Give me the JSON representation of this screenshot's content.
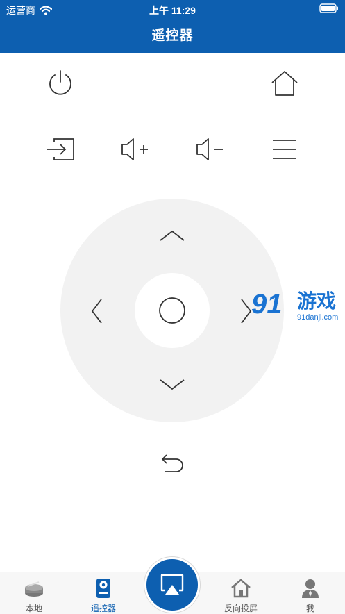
{
  "colors": {
    "brand": "#0d5fb0",
    "pad": "#f2f2f2"
  },
  "status": {
    "carrier": "运营商",
    "time": "上午 11:29"
  },
  "header": {
    "title": "遥控器"
  },
  "remote": {
    "power": "power-icon",
    "home": "home-icon",
    "input": "input-source-icon",
    "volume_up": "volume-up-icon",
    "volume_down": "volume-down-icon",
    "menu": "menu-icon",
    "up": "chevron-up-icon",
    "down": "chevron-down-icon",
    "left": "chevron-left-icon",
    "right": "chevron-right-icon",
    "ok": "ok-circle-icon",
    "back": "back-arrow-icon"
  },
  "watermark": {
    "logo": "91",
    "name": "游戏",
    "url": "91danji.com"
  },
  "tabs": [
    {
      "label": "本地",
      "icon": "local-files-icon"
    },
    {
      "label": "遥控器",
      "icon": "remote-control-icon",
      "active": true
    },
    {
      "label": "",
      "icon": "screen-cast-icon"
    },
    {
      "label": "反向投屏",
      "icon": "reverse-cast-home-icon"
    },
    {
      "label": "我",
      "icon": "user-icon"
    }
  ]
}
